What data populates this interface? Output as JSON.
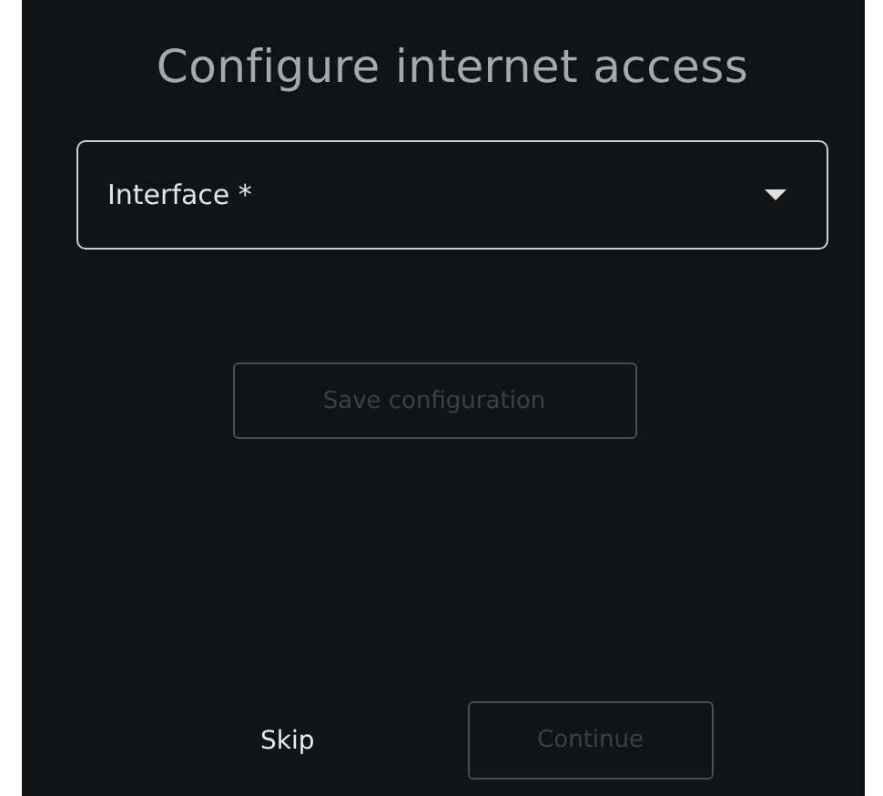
{
  "title": "Configure internet access",
  "interface_field": {
    "placeholder": "Interface *"
  },
  "save_button": {
    "label": "Save configuration",
    "disabled": true
  },
  "skip_button": {
    "label": "Skip",
    "disabled": false
  },
  "continue_button": {
    "label": "Continue",
    "disabled": true
  }
}
